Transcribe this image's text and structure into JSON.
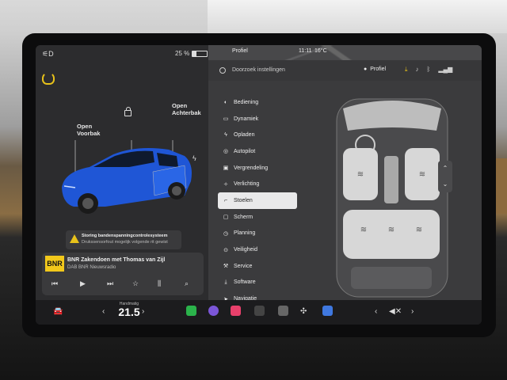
{
  "status": {
    "battery": "25 %",
    "battery_level": 0.25
  },
  "left": {
    "frunk": [
      "Open",
      "Voorbak"
    ],
    "trunk": [
      "Open",
      "Achterbak"
    ],
    "alert_title": "Storing bandenspanningcontrolesysteem",
    "alert_sub": "Drukssensorfout mogelijk volgende rit gewist",
    "media": {
      "logo": "BNR",
      "station": "BNR Zakendoen met Thomas van Zijl",
      "source": "DAB BNR Nieuwsradio"
    }
  },
  "map": {
    "profile": "Profiel",
    "time": "11:11",
    "temp": "16°C"
  },
  "settings": {
    "search_placeholder": "Doorzoek instellingen",
    "profile": "Profiel",
    "menu": [
      {
        "label": "Bediening",
        "icon": "toggle-icon"
      },
      {
        "label": "Dynamiek",
        "icon": "car-icon"
      },
      {
        "label": "Opladen",
        "icon": "lightning-icon"
      },
      {
        "label": "Autopilot",
        "icon": "steering-icon"
      },
      {
        "label": "Vergrendeling",
        "icon": "lock-icon"
      },
      {
        "label": "Verlichting",
        "icon": "bulb-icon"
      },
      {
        "label": "Stoelen",
        "icon": "seat-icon",
        "selected": true
      },
      {
        "label": "Scherm",
        "icon": "screen-icon"
      },
      {
        "label": "Planning",
        "icon": "clock-icon"
      },
      {
        "label": "Veiligheid",
        "icon": "shield-icon"
      },
      {
        "label": "Service",
        "icon": "wrench-icon"
      },
      {
        "label": "Software",
        "icon": "download-icon"
      },
      {
        "label": "Navigatie",
        "icon": "navigation-icon"
      }
    ]
  },
  "dock": {
    "temp_label": "Handmatig",
    "temp": "21.5"
  },
  "colors": {
    "accent_yellow": "#f2c81b",
    "car_blue": "#1f56d6"
  }
}
